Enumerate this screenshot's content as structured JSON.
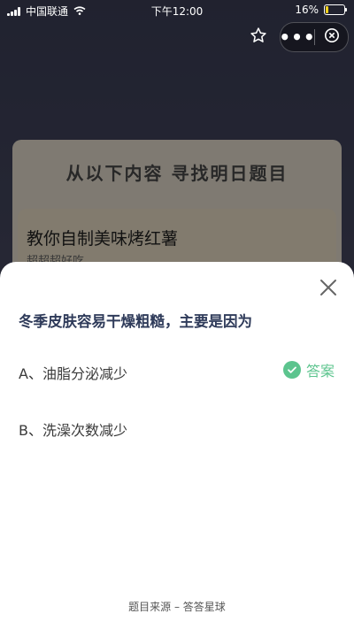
{
  "status_bar": {
    "carrier": "中国联通",
    "time": "下午12:00",
    "battery_percent": "16%",
    "battery_level": 0.16
  },
  "background": {
    "banner_title": "从以下内容 寻找明日题目",
    "topic_title": "教你自制美味烤红薯",
    "topic_subtitle": "超超超好吃"
  },
  "quiz": {
    "question": "冬季皮肤容易干燥粗糙，主要是因为",
    "options": [
      {
        "label": "A、油脂分泌减少",
        "is_answer": true
      },
      {
        "label": "B、洗澡次数减少",
        "is_answer": false
      }
    ],
    "answer_label": "答案",
    "source": "题目来源 – 答答星球"
  },
  "colors": {
    "accent_green": "#5cc48e",
    "question_text": "#2f3b5a"
  },
  "icons": [
    "star-icon",
    "more-icon",
    "close-circle-icon",
    "close-icon",
    "check-icon"
  ]
}
